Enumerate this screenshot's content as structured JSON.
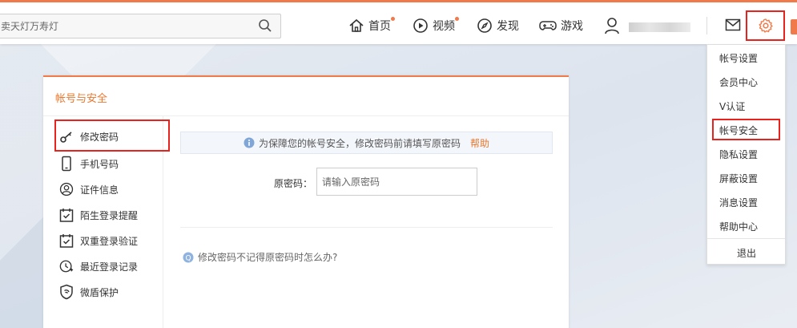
{
  "search": {
    "value": "卖天灯万寿灯"
  },
  "nav": {
    "home": "首页",
    "video": "视频",
    "discover": "发现",
    "games": "游戏"
  },
  "colors": {
    "accent": "#f07a4a",
    "highlight": "#e8221c",
    "link": "#e8782f"
  },
  "dropdown": {
    "items": [
      "帐号设置",
      "会员中心",
      "V认证",
      "帐号安全",
      "隐私设置",
      "屏蔽设置",
      "消息设置",
      "帮助中心"
    ],
    "logout": "退出",
    "selected": "帐号安全"
  },
  "panel": {
    "title": "帐号与安全",
    "menu": [
      "修改密码",
      "手机号码",
      "证件信息",
      "陌生登录提醒",
      "双重登录验证",
      "最近登录记录",
      "微盾保护"
    ],
    "selected": "修改密码"
  },
  "notice": {
    "text": "为保障您的帐号安全，修改密码前请填写原密码",
    "help": "帮助"
  },
  "form": {
    "label": "原密码：",
    "placeholder": "请输入原密码"
  },
  "forgot": "修改密码不记得原密码时怎么办?"
}
